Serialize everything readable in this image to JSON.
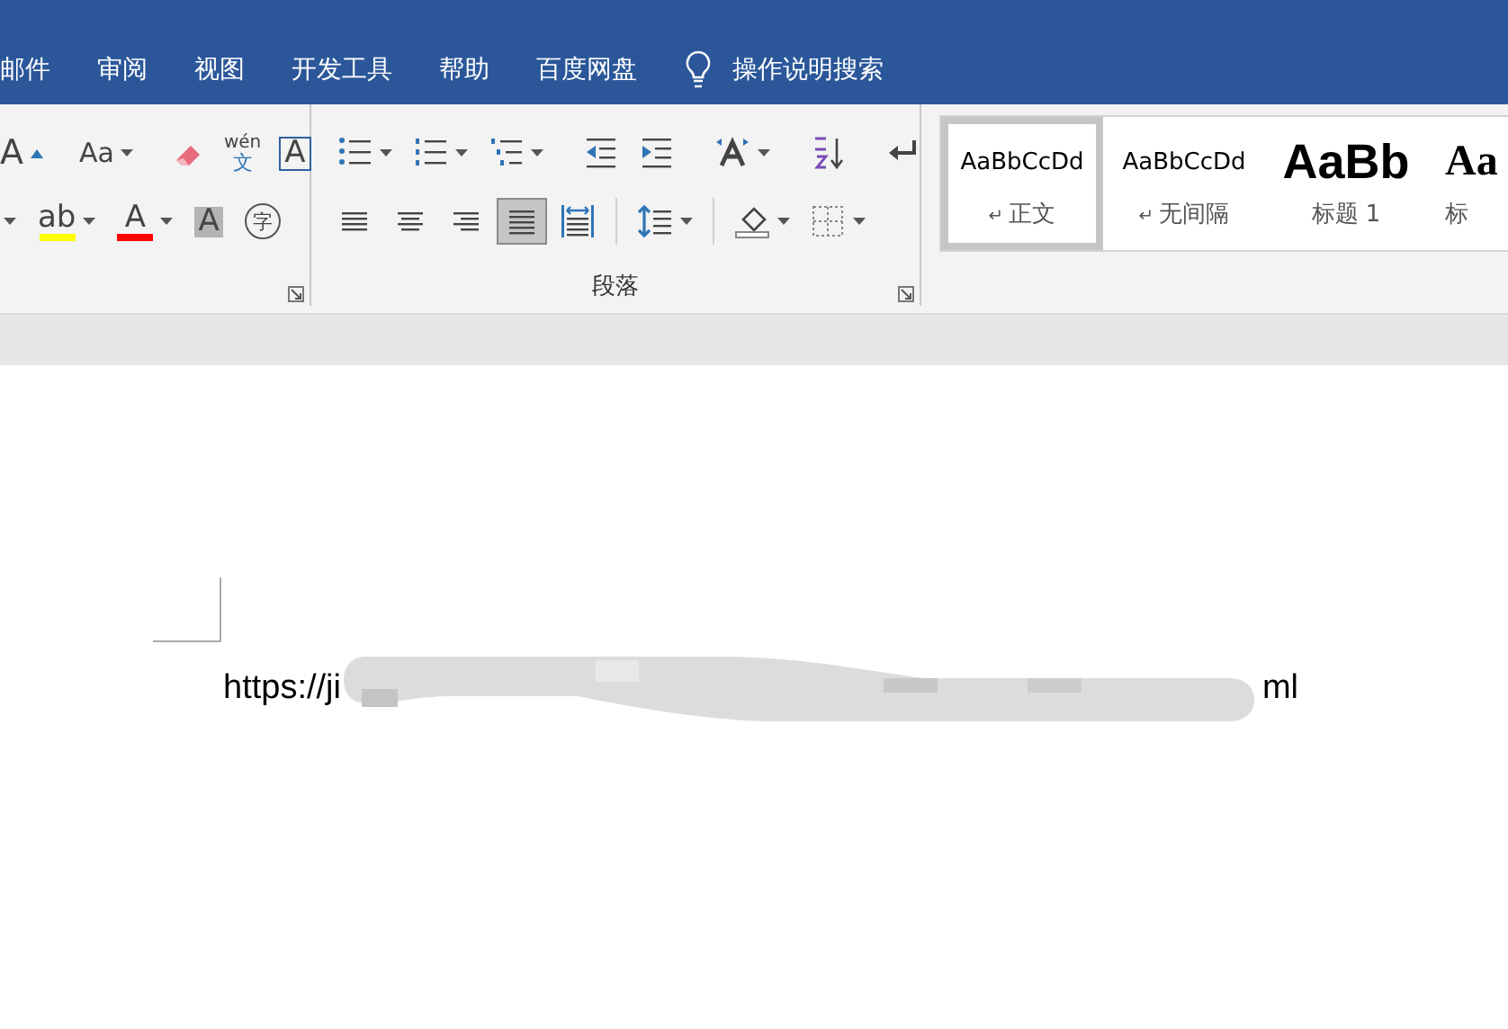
{
  "tabs": [
    {
      "label": "邮件",
      "selected": false
    },
    {
      "label": "审阅",
      "selected": false
    },
    {
      "label": "视图",
      "selected": false
    },
    {
      "label": "开发工具",
      "selected": false
    },
    {
      "label": "帮助",
      "selected": false
    },
    {
      "label": "百度网盘",
      "selected": false
    }
  ],
  "tell_me": {
    "label": "操作说明搜索"
  },
  "font_group": {
    "rows": [
      [
        {
          "glyph": "A",
          "dropdown": false
        },
        {
          "glyph": "Aa",
          "dropdown": true
        },
        {
          "dropdown": false
        },
        {
          "glyph": "wén",
          "sub": "文",
          "dropdown": false
        },
        {
          "glyph": "A",
          "dropdown": false
        }
      ],
      [
        {
          "dropdown": true
        },
        {
          "glyph": "ab",
          "color": "#ffff00",
          "dropdown": true
        },
        {
          "glyph": "A",
          "color": "#ff0000",
          "dropdown": true
        },
        {
          "glyph": "A",
          "dropdown": false
        },
        {
          "glyph": "字",
          "dropdown": false
        }
      ]
    ]
  },
  "paragraph_group": {
    "label": "段落",
    "rows": [
      [
        {
          "dropdown": true,
          "selected": false
        },
        {
          "dropdown": true,
          "selected": false
        },
        {
          "dropdown": true,
          "selected": false
        },
        {
          "dropdown": false,
          "selected": false
        },
        {
          "dropdown": false,
          "selected": false
        },
        {
          "dropdown": true,
          "selected": false
        },
        {
          "dropdown": false,
          "selected": false
        },
        {
          "dropdown": false,
          "selected": false
        }
      ],
      [
        {
          "dropdown": false,
          "selected": false
        },
        {
          "dropdown": false,
          "selected": false
        },
        {
          "dropdown": false,
          "selected": false
        },
        {
          "dropdown": false,
          "selected": true
        },
        {
          "dropdown": false,
          "selected": false
        },
        {
          "dropdown": true,
          "selected": false
        },
        {
          "dropdown": true,
          "selected": false
        },
        {
          "dropdown": true,
          "selected": false
        }
      ]
    ]
  },
  "styles": [
    {
      "sample": "AaBbCcDd",
      "prefix": "↵",
      "name": "正文",
      "selected": true
    },
    {
      "sample": "AaBbCcDd",
      "prefix": "↵",
      "name": "无间隔",
      "selected": false
    },
    {
      "sample": "AaBb",
      "name": "标题 1",
      "selected": false
    },
    {
      "sample": "Aa",
      "name": "标",
      "selected": false
    }
  ],
  "document": {
    "text_start": "https://ji",
    "text_end": "ml"
  }
}
